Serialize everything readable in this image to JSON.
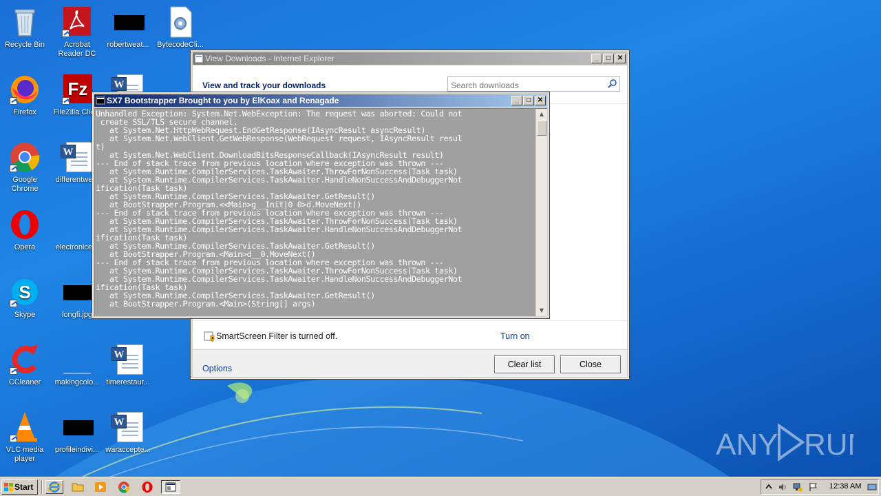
{
  "desktop": {
    "icons": [
      {
        "label": "Recycle Bin"
      },
      {
        "label": "Acrobat Reader DC"
      },
      {
        "label": "robertweat..."
      },
      {
        "label": "BytecodeCli..."
      },
      {
        "label": "Firefox"
      },
      {
        "label": "FileZilla Client"
      },
      {
        "label": ""
      },
      {
        "label": "Google Chrome"
      },
      {
        "label": "differentwe..."
      },
      {
        "label": "Opera"
      },
      {
        "label": "electronice..."
      },
      {
        "label": "Skype"
      },
      {
        "label": "longfi.jpg"
      },
      {
        "label": "CCleaner"
      },
      {
        "label": "makingcolo..."
      },
      {
        "label": "timerestaur..."
      },
      {
        "label": "VLC media player"
      },
      {
        "label": "profileindivi..."
      },
      {
        "label": "waraccepte..."
      }
    ]
  },
  "ie_window": {
    "title": "View Downloads - Internet Explorer",
    "heading": "View and track your downloads",
    "search_placeholder": "Search downloads",
    "smartscreen_text": "SmartScreen Filter is turned off.",
    "turn_on": "Turn on",
    "options": "Options",
    "clear_list": "Clear list",
    "close": "Close"
  },
  "console_window": {
    "title": "SX7 Bootstrapper Brought to you by ElKoax and Renagade",
    "lines": [
      "Unhandled Exception: System.Net.WebException: The request was aborted: Could not",
      " create SSL/TLS secure channel.",
      "   at System.Net.HttpWebRequest.EndGetResponse(IAsyncResult asyncResult)",
      "   at System.Net.WebClient.GetWebResponse(WebRequest request, IAsyncResult resul",
      "t)",
      "   at System.Net.WebClient.DownloadBitsResponseCallback(IAsyncResult result)",
      "--- End of stack trace from previous location where exception was thrown ---",
      "   at System.Runtime.CompilerServices.TaskAwaiter.ThrowForNonSuccess(Task task)",
      "   at System.Runtime.CompilerServices.TaskAwaiter.HandleNonSuccessAndDebuggerNot",
      "ification(Task task)",
      "   at System.Runtime.CompilerServices.TaskAwaiter.GetResult()",
      "   at BootStrapper.Program.<<Main>g__Init|0_0>d.MoveNext()",
      "--- End of stack trace from previous location where exception was thrown ---",
      "   at System.Runtime.CompilerServices.TaskAwaiter.ThrowForNonSuccess(Task task)",
      "   at System.Runtime.CompilerServices.TaskAwaiter.HandleNonSuccessAndDebuggerNot",
      "ification(Task task)",
      "   at System.Runtime.CompilerServices.TaskAwaiter.GetResult()",
      "   at BootStrapper.Program.<Main>d__0.MoveNext()",
      "--- End of stack trace from previous location where exception was thrown ---",
      "   at System.Runtime.CompilerServices.TaskAwaiter.ThrowForNonSuccess(Task task)",
      "   at System.Runtime.CompilerServices.TaskAwaiter.HandleNonSuccessAndDebuggerNot",
      "ification(Task task)",
      "   at System.Runtime.CompilerServices.TaskAwaiter.GetResult()",
      "   at BootStrapper.Program.<Main>(String[] args)"
    ]
  },
  "taskbar": {
    "start_label": "Start",
    "clock": "12:38 AM"
  },
  "watermark": {
    "text": "ANY RUN"
  },
  "colors": {
    "desktop_blue": "#1f86e6",
    "titlebar_active": "#0a246a",
    "console_bg": "#a0a0a0",
    "link_blue": "#0c3ea8"
  }
}
